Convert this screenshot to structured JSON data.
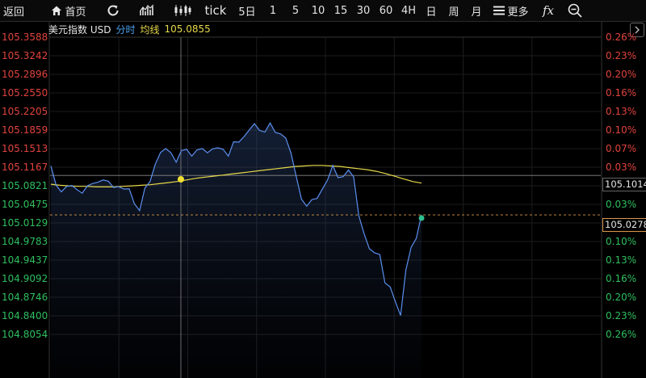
{
  "toolbar": {
    "back": "返回",
    "home": "首页",
    "tick": "tick",
    "periods": [
      "5日",
      "1",
      "5",
      "10",
      "15",
      "30",
      "60",
      "4H",
      "日",
      "周",
      "月"
    ],
    "more": "更多",
    "fx": "fx"
  },
  "info": {
    "name": "美元指数 USD",
    "mode": "分时",
    "avg_label": "均线",
    "avg_value": "105.0855"
  },
  "axis_left": [
    "105.3588",
    "105.3242",
    "105.2896",
    "105.2550",
    "105.2205",
    "105.1859",
    "105.1513",
    "105.1167",
    "105.0821",
    "105.0475",
    "105.0129",
    "104.9783",
    "104.9437",
    "104.9092",
    "104.8746",
    "104.8400",
    "104.8054"
  ],
  "axis_right": [
    "0.26%",
    "0.23%",
    "0.20%",
    "0.16%",
    "0.13%",
    "0.10%",
    "0.07%",
    "0.03%",
    "",
    "0.03%",
    "",
    "0.10%",
    "0.13%",
    "0.16%",
    "0.20%",
    "0.23%",
    "0.26%"
  ],
  "tags": {
    "prev_close": "105.1014",
    "last": "105.0278"
  },
  "colors": {
    "up": "#e0443e",
    "down": "#2fbf5f",
    "price_line": "#5b8ff0",
    "avg_line": "#e6d84a",
    "ref_line": "#8a8a8a",
    "last_line": "#d9984a"
  },
  "chart_data": {
    "type": "line",
    "reference_price": 105.1014,
    "ylim": [
      104.8054,
      105.3588
    ],
    "series": [
      {
        "name": "分时",
        "values": [
          105.115,
          105.082,
          105.072,
          105.085,
          105.08,
          105.075,
          105.071,
          105.078,
          105.085,
          105.09,
          105.097,
          105.088,
          105.079,
          105.083,
          105.072,
          105.075,
          105.05,
          105.04,
          105.075,
          105.09,
          105.125,
          105.14,
          105.15,
          105.145,
          105.13,
          105.145,
          105.15,
          105.14,
          105.145,
          105.15,
          105.145,
          105.155,
          105.15,
          105.15,
          105.14,
          105.16,
          105.162,
          105.175,
          105.19,
          105.195,
          105.185,
          105.185,
          105.195,
          105.18,
          105.18,
          105.175,
          105.14,
          105.1,
          105.06,
          105.04,
          105.055,
          105.06,
          105.08,
          105.09,
          105.12,
          105.1,
          105.095,
          105.11,
          105.1,
          105.03,
          104.99,
          104.965,
          104.96,
          104.95,
          104.9,
          104.895,
          104.87,
          104.838,
          104.925,
          104.97,
          104.98,
          105.028
        ]
      },
      {
        "name": "均线",
        "values": [
          105.085,
          105.083,
          105.082,
          105.081,
          105.081,
          105.08,
          105.08,
          105.08,
          105.081,
          105.082,
          105.083,
          105.084,
          105.086,
          105.088,
          105.09,
          105.093,
          105.096,
          105.098,
          105.1,
          105.102,
          105.104,
          105.106,
          105.108,
          105.11,
          105.112,
          105.114,
          105.116,
          105.118,
          105.119,
          105.12,
          105.12,
          105.119,
          105.118,
          105.116,
          105.114,
          105.112,
          105.109,
          105.105,
          105.1,
          105.095,
          105.09,
          105.087
        ]
      }
    ]
  }
}
